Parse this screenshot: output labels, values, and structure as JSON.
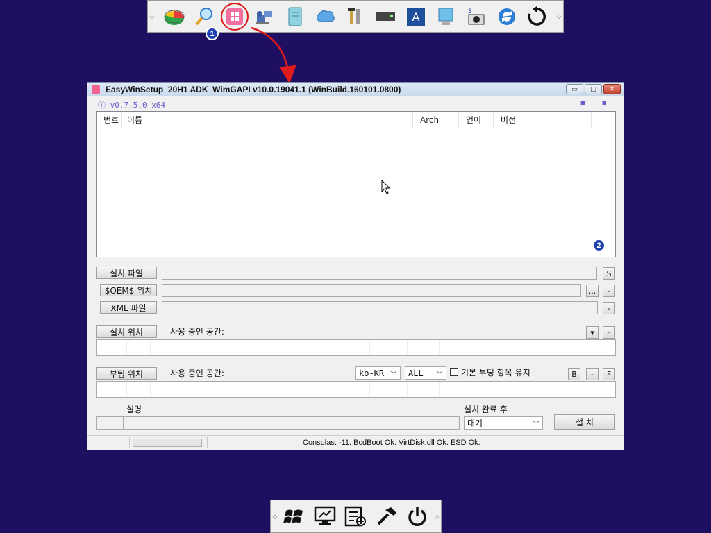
{
  "top_toolbar": {
    "icons": [
      "partition-icon",
      "search-icon",
      "windows-setup-icon",
      "network-icon",
      "notepad-icon",
      "cloud-icon",
      "tools-icon",
      "drive-icon",
      "a-icon",
      "monitor-icon",
      "camera-icon",
      "refresh-icon",
      "reload-icon"
    ]
  },
  "bottom_toolbar": {
    "icons": [
      "windows-flag-icon",
      "computer-icon",
      "task-list-icon",
      "hammer-icon",
      "power-icon"
    ]
  },
  "annotations": {
    "marker1": "1",
    "marker2": "2",
    "color": "#e01b1b"
  },
  "window": {
    "title": "EasyWinSetup  20H1 ADK  WimGAPI v10.0.19041.1 (WinBuild.160101.0800)",
    "version": "ⓘ v0.7.5.0 x64",
    "corner_dots": "▪ ▪",
    "controls": {
      "minimize": "▭",
      "maximize": "□",
      "close": "✕"
    },
    "list": {
      "columns": [
        "번호",
        "이름",
        "Arch",
        "언어",
        "버전"
      ]
    },
    "install_file": {
      "button": "설치 파일",
      "value": "",
      "s_button": "S"
    },
    "oem": {
      "button": "$OEM$ 위치",
      "value": "",
      "browse": "...",
      "minus": "-"
    },
    "xml": {
      "button": "XML 파일",
      "value": "",
      "minus": "-"
    },
    "install_location": {
      "button": "설치 위치",
      "used_space": "사용 중인 공간:",
      "dropdown": "▾",
      "f_button": "F"
    },
    "boot_location": {
      "button": "부팅 위치",
      "used_space": "사용 중인 공간:",
      "lang_select": "ko-KR",
      "all_select": "ALL",
      "keep_boot_label": "기본 부팅 항목 유지",
      "b_button": "B",
      "minus": "-",
      "f_button": "F"
    },
    "description": {
      "label": "설명",
      "value": ""
    },
    "after_install": {
      "label": "설치 완료 후",
      "selected": "대기",
      "install_button": "설 치"
    },
    "status": {
      "text": "Consolas: -11. BcdBoot Ok. VirtDisk.dll Ok. ESD Ok."
    }
  }
}
